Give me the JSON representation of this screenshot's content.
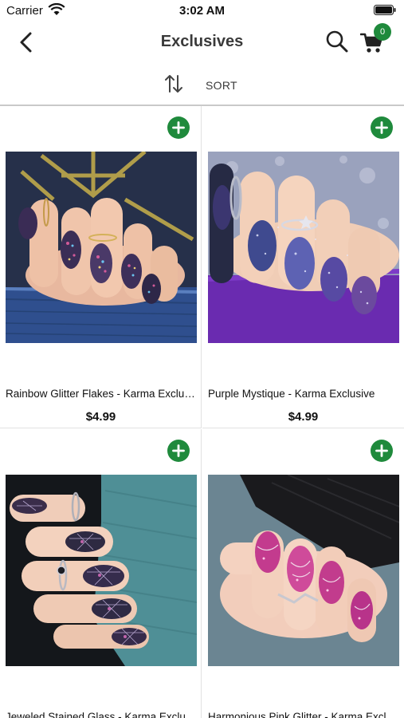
{
  "status_bar": {
    "carrier": "Carrier",
    "time": "3:02 AM"
  },
  "header": {
    "title": "Exclusives",
    "cart_count": "0"
  },
  "sort": {
    "label": "SORT"
  },
  "products": [
    {
      "name": "Rainbow Glitter Flakes - Karma Exclusive",
      "price": "$4.99"
    },
    {
      "name": "Purple Mystique - Karma Exclusive",
      "price": "$4.99"
    },
    {
      "name": "Jeweled Stained Glass - Karma Exclusive",
      "price": ""
    },
    {
      "name": "Harmonious Pink Glitter - Karma Exclusive",
      "price": ""
    }
  ],
  "colors": {
    "accent": "#1f8a3c",
    "title": "#3a3a3a"
  }
}
